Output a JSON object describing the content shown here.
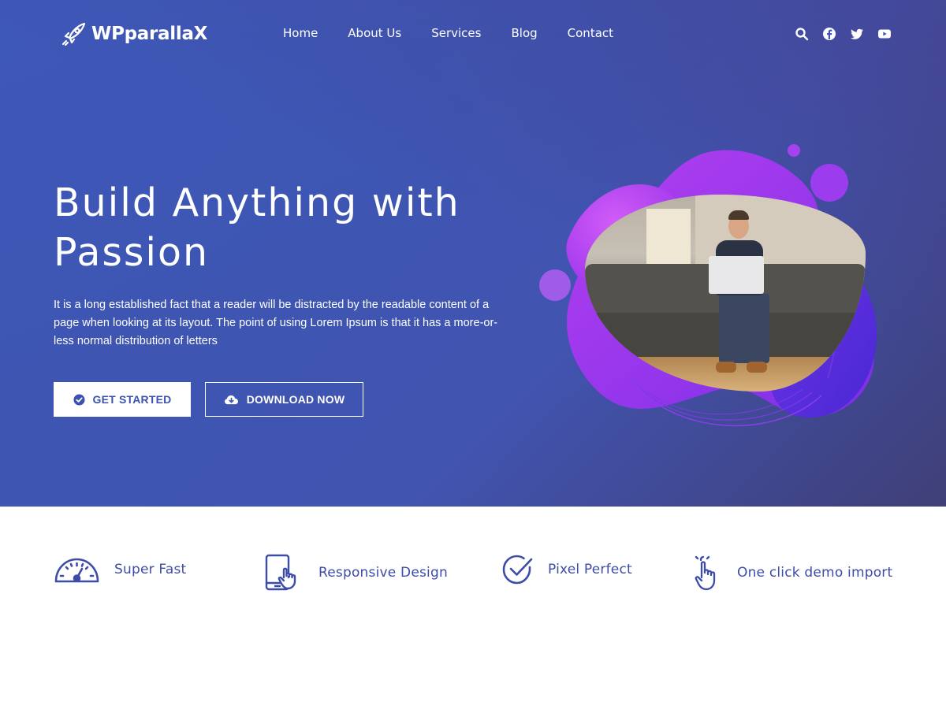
{
  "header": {
    "logo_text": "WPparallaX",
    "nav": [
      {
        "label": "Home"
      },
      {
        "label": "About Us"
      },
      {
        "label": "Services"
      },
      {
        "label": "Blog"
      },
      {
        "label": "Contact"
      }
    ],
    "icons": [
      "search-icon",
      "facebook-icon",
      "twitter-icon",
      "youtube-icon"
    ]
  },
  "hero": {
    "title": "Build Anything with Passion",
    "text": "It is a long established fact that a reader will be distracted by the readable content of a page when looking at its layout. The point of using Lorem Ipsum is that it has a more-or-less normal distribution of letters",
    "primary_button": {
      "label": "GET STARTED",
      "icon": "check-circle-icon"
    },
    "secondary_button": {
      "label": "DOWNLOAD NOW",
      "icon": "cloud-download-icon"
    }
  },
  "features": [
    {
      "label": "Super Fast",
      "icon": "speedometer-icon"
    },
    {
      "label": "Responsive Design",
      "icon": "tablet-touch-icon"
    },
    {
      "label": "Pixel Perfect",
      "icon": "check-circle-icon"
    },
    {
      "label": "One click demo import",
      "icon": "pointer-hand-icon"
    }
  ],
  "colors": {
    "hero_bg": "#3f56b4",
    "accent_purple": "#a33ef0",
    "feature_text": "#3c4ca8",
    "white": "#ffffff"
  }
}
